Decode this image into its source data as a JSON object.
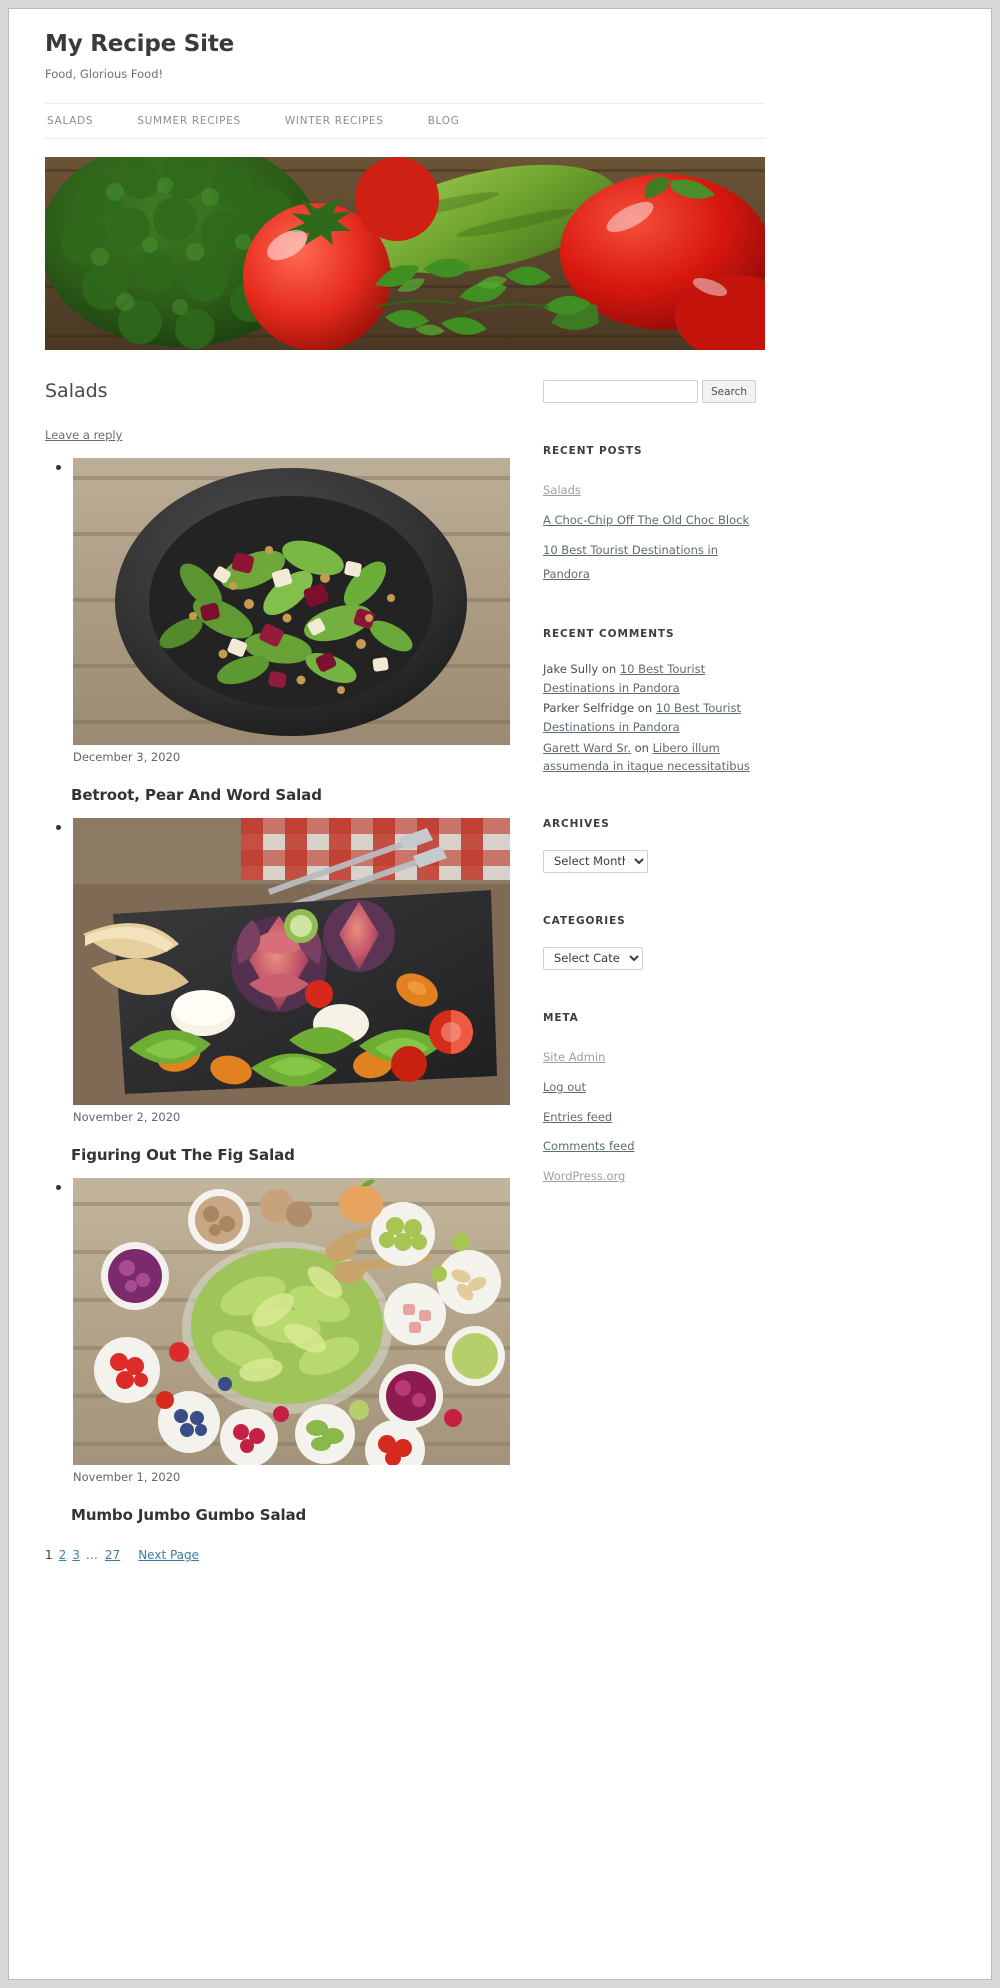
{
  "site": {
    "title": "My Recipe Site",
    "tagline": "Food, Glorious Food!"
  },
  "nav": {
    "items": [
      {
        "label": "SALADS"
      },
      {
        "label": "SUMMER RECIPES"
      },
      {
        "label": "WINTER RECIPES"
      },
      {
        "label": "BLOG"
      }
    ]
  },
  "banner": {
    "alt": "Fresh vegetables: broccoli, tomatoes, cucumber, red bell peppers and parsley on a wooden table"
  },
  "main": {
    "page_title": "Salads",
    "leave_reply": "Leave a reply",
    "posts": [
      {
        "date": "December 3, 2020",
        "title": "Betroot, Pear And Word Salad",
        "image_alt": "Beetroot, pear and walnut salad in a dark bowl on rustic wood"
      },
      {
        "date": "November 2, 2020",
        "title": "Figuring Out The Fig Salad",
        "image_alt": "Fig salad with goat cheese, carrots, bread and tomatoes on a slate board"
      },
      {
        "date": "November 1, 2020",
        "title": "Mumbo Jumbo Gumbo Salad",
        "image_alt": "Large glass bowl of green salad surrounded by small bowls of fruit, nuts and berries"
      }
    ],
    "pagination": {
      "pages": [
        "1",
        "2",
        "3"
      ],
      "current": "1",
      "ellipsis": "…",
      "last": "27",
      "next_label": "Next Page"
    }
  },
  "sidebar": {
    "search": {
      "value": "",
      "placeholder": "",
      "button_label": "Search"
    },
    "recent_posts": {
      "title": "RECENT POSTS",
      "items": [
        {
          "label": "Salads",
          "muted": true
        },
        {
          "label": "A Choc-Chip Off The Old Choc Block",
          "muted": false
        },
        {
          "label": "10 Best Tourist Destinations in Pandora",
          "muted": false
        }
      ]
    },
    "recent_comments": {
      "title": "RECENT COMMENTS",
      "items": [
        {
          "author": "Jake Sully",
          "on": "on",
          "post": "10 Best Tourist Destinations in Pandora",
          "author_link": false
        },
        {
          "author": "Parker Selfridge",
          "on": "on",
          "post": "10 Best Tourist Destinations in Pandora",
          "author_link": false
        },
        {
          "author": "Garett Ward Sr.",
          "on": "on",
          "post": "Libero illum assumenda in itaque necessitatibus",
          "author_link": true
        }
      ]
    },
    "archives": {
      "title": "ARCHIVES",
      "selected": "Select Month"
    },
    "categories": {
      "title": "CATEGORIES",
      "selected": "Select Category"
    },
    "meta": {
      "title": "META",
      "items": [
        {
          "label": "Site Admin",
          "muted": true
        },
        {
          "label": "Log out",
          "muted": false
        },
        {
          "label": "Entries feed",
          "muted": false
        },
        {
          "label": "Comments feed",
          "muted": false
        },
        {
          "label": "WordPress.org",
          "muted": true
        }
      ]
    }
  },
  "colors": {
    "link": "#5f6b72",
    "text": "#333333",
    "muted": "#8d8d8d",
    "pagination_link": "#3c7ea3"
  }
}
